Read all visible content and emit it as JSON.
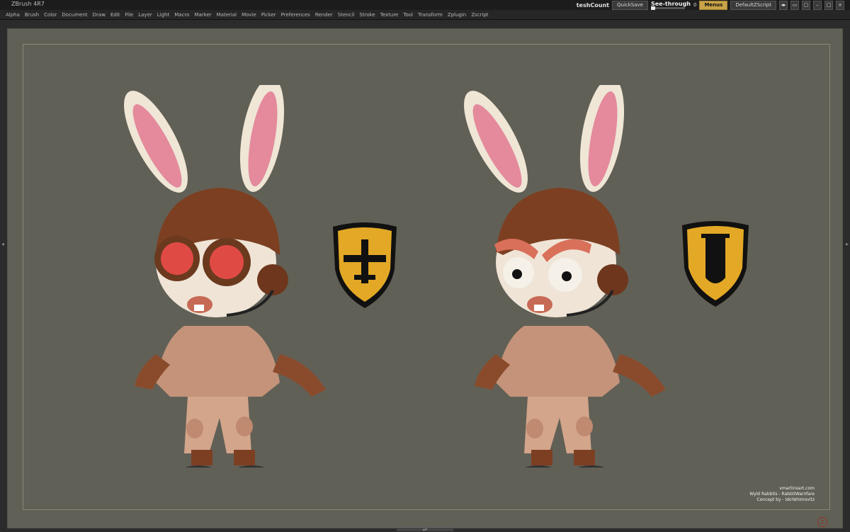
{
  "app": {
    "title": "ZBrush 4R7",
    "mesh_count_label": "teshCount",
    "quicksave_label": "QuickSave",
    "see_through_label": "See-through",
    "see_through_value": "0",
    "menus_label": "Menus",
    "script_label": "DefaultZScript"
  },
  "menubar": {
    "items": [
      "Alpha",
      "Brush",
      "Color",
      "Document",
      "Draw",
      "Edit",
      "File",
      "Layer",
      "Light",
      "Macro",
      "Marker",
      "Material",
      "Movie",
      "Picker",
      "Preferences",
      "Render",
      "Stencil",
      "Stroke",
      "Texture",
      "Tool",
      "Transform",
      "Zplugin",
      "Zscript"
    ]
  },
  "canvas": {
    "background": "#616056",
    "credits": {
      "site": "vmartinsart.com",
      "line2": "Wyld Rabbits - RabbitWarnfare",
      "line3": "Concept by - IdoYehimovitz"
    }
  },
  "colors": {
    "badge_yellow": "#e3a826",
    "jacket": "#c4937a",
    "helmet": "#7d3f22",
    "goggles": "#e04a45"
  }
}
